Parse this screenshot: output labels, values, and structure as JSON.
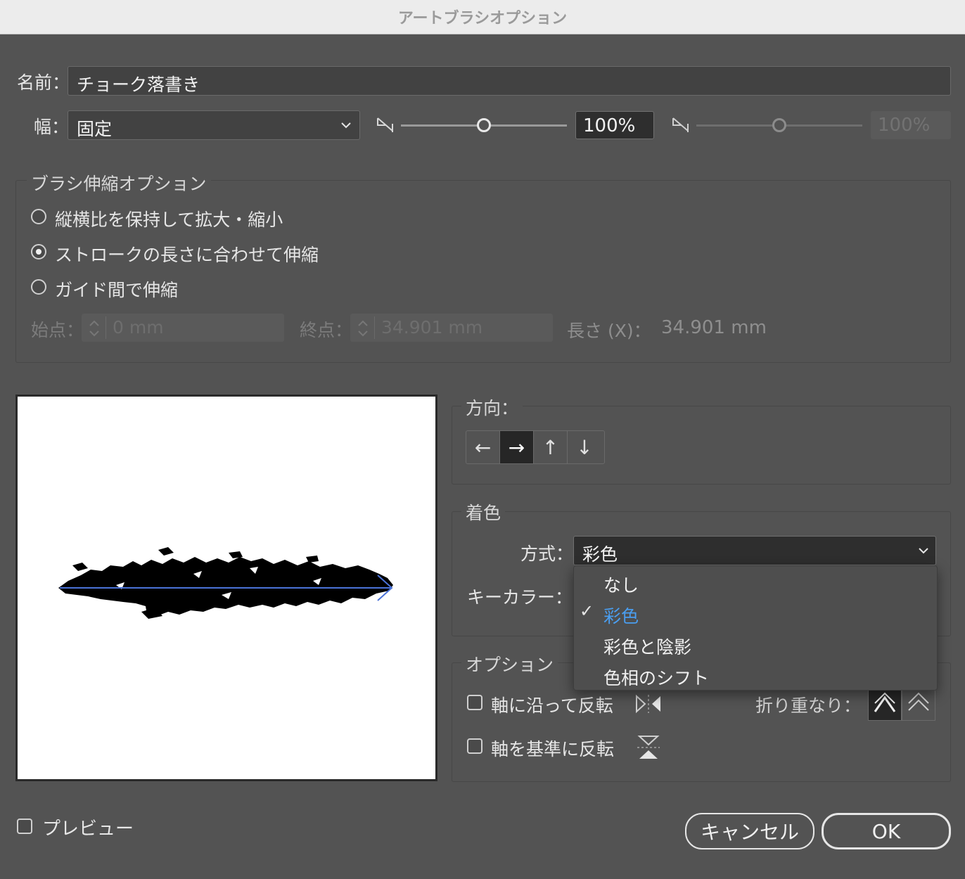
{
  "window": {
    "title": "アートブラシオプション"
  },
  "name": {
    "label": "名前：",
    "value": "チョーク落書き"
  },
  "width": {
    "label": "幅：",
    "select_value": "固定",
    "min_pct": "100%",
    "max_pct": "100%"
  },
  "scale_options": {
    "title": "ブラシ伸縮オプション",
    "options": [
      {
        "label": "縦横比を保持して拡大・縮小",
        "selected": false
      },
      {
        "label": "ストロークの長さに合わせて伸縮",
        "selected": true
      },
      {
        "label": "ガイド間で伸縮",
        "selected": false
      }
    ],
    "start_label": "始点：",
    "start_value": "0 mm",
    "end_label": "終点：",
    "end_value": "34.901 mm",
    "length_label": "長さ (X)：",
    "length_value": "34.901 mm"
  },
  "direction": {
    "title": "方向：",
    "buttons": [
      {
        "icon": "arrow-left-icon",
        "glyph": "←",
        "active": false
      },
      {
        "icon": "arrow-right-icon",
        "glyph": "→",
        "active": true
      },
      {
        "icon": "arrow-up-icon",
        "glyph": "↑",
        "active": false
      },
      {
        "icon": "arrow-down-icon",
        "glyph": "↓",
        "active": false
      }
    ]
  },
  "colorization": {
    "title": "着色",
    "method_label": "方式：",
    "method_value": "彩色",
    "key_color_label": "キーカラー：",
    "menu": [
      {
        "label": "なし",
        "checked": false
      },
      {
        "label": "彩色",
        "checked": true
      },
      {
        "label": "彩色と陰影",
        "checked": false
      },
      {
        "label": "色相のシフト",
        "checked": false
      }
    ],
    "check_glyph": "✓",
    "accent": "#4a9ef0"
  },
  "options": {
    "title": "オプション",
    "flip_along": "軸に沿って反転",
    "flip_across": "軸を基準に反転",
    "overlap_label": "折り重なり："
  },
  "footer": {
    "preview_label": "プレビュー",
    "cancel_label": "キャンセル",
    "ok_label": "OK"
  }
}
